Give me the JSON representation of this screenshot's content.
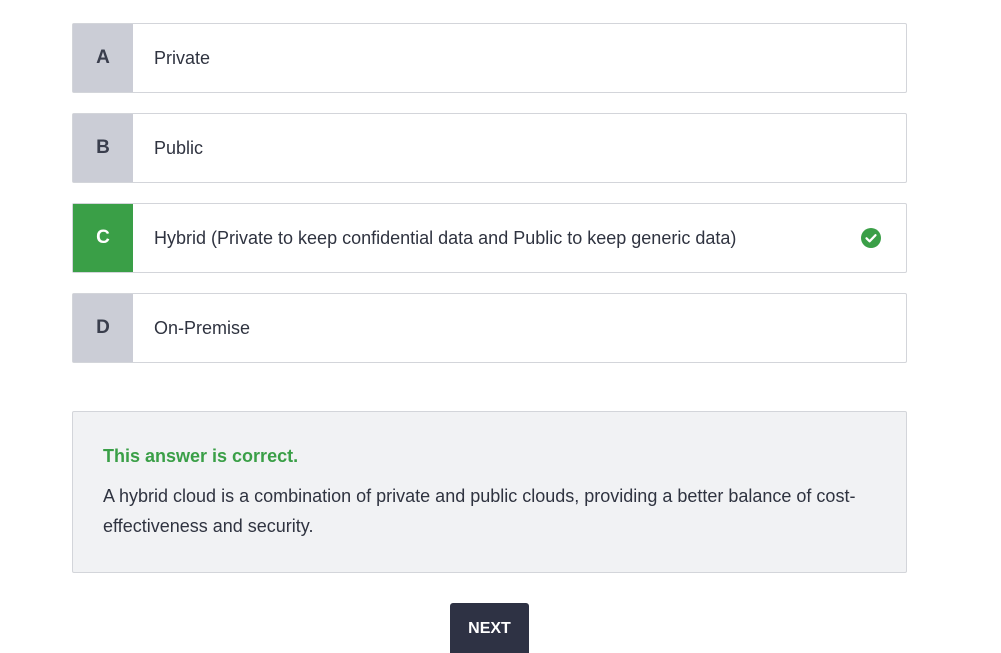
{
  "options": [
    {
      "letter": "A",
      "text": "Private",
      "state": "default"
    },
    {
      "letter": "B",
      "text": "Public",
      "state": "default"
    },
    {
      "letter": "C",
      "text": "Hybrid (Private to keep confidential data and Public to keep generic data)",
      "state": "correct"
    },
    {
      "letter": "D",
      "text": "On-Premise",
      "state": "default"
    }
  ],
  "feedback": {
    "status": "This answer is correct.",
    "explanation": "A hybrid cloud is a combination of private and public clouds, providing a better balance of cost-effectiveness and security."
  },
  "next_button": {
    "label": "NEXT"
  },
  "colors": {
    "correct": "#3a9f47",
    "letter_default_bg": "#cbcdd6",
    "button_bg": "#2e3244",
    "feedback_bg": "#f1f2f4"
  },
  "icons": {
    "correct_check": "check-circle-icon"
  }
}
